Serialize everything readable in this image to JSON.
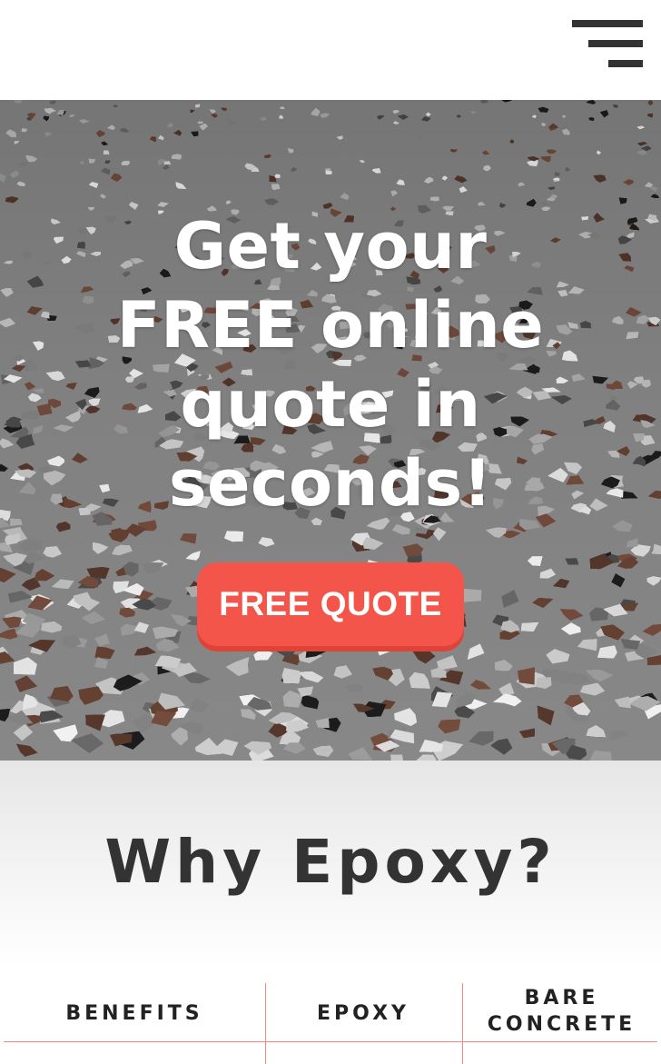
{
  "header": {
    "menu_icon": "hamburger-menu-icon"
  },
  "hero": {
    "headline_lines": [
      "Get your",
      "FREE online",
      "quote in",
      "seconds!"
    ],
    "cta_label": "FREE QUOTE",
    "cta_color": "#f4554a",
    "background": "epoxy flake floor photo"
  },
  "why": {
    "title": "Why Epoxy?"
  },
  "comparison": {
    "columns": [
      "BENEFITS",
      "EPOXY",
      "BARE CONCRETE"
    ],
    "line_color": "#f08a80"
  }
}
